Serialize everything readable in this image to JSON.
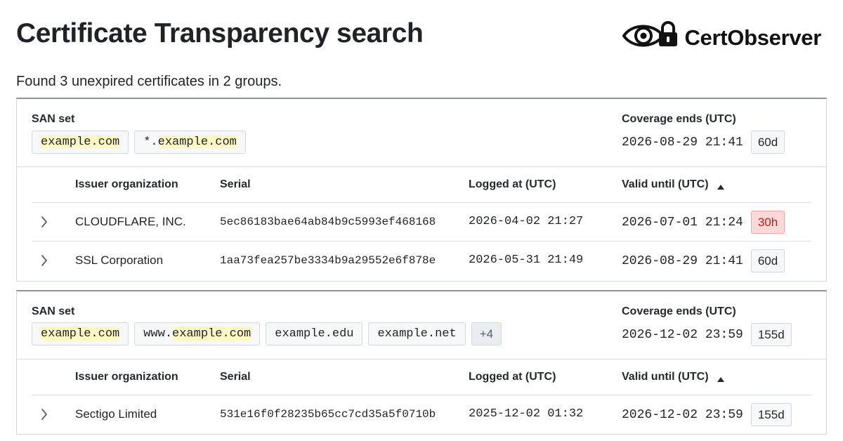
{
  "header": {
    "title": "Certificate Transparency search",
    "brand": "CertObserver",
    "logo_icon": "eye-lock-icon"
  },
  "summary": "Found 3 unexpired certificates in 2 groups.",
  "labels": {
    "san_set": "SAN set",
    "coverage_ends": "Coverage ends (UTC)"
  },
  "columns": {
    "issuer": "Issuer organization",
    "serial": "Serial",
    "logged": "Logged at (UTC)",
    "valid": "Valid until (UTC)",
    "sort_icon": "sort-ascending-icon"
  },
  "groups": [
    {
      "sans": [
        {
          "prefix": "",
          "domain": "example.com"
        },
        {
          "prefix": "*.",
          "domain": "example.com"
        }
      ],
      "coverage_date": "2026-08-29 21:41",
      "coverage_badge": "60d",
      "rows": [
        {
          "issuer": "CLOUDFLARE, INC.",
          "serial": "5ec86183bae64ab84b9c5993ef468168",
          "logged": "2026-04-02 21:27",
          "valid": "2026-07-01 21:24",
          "badge": "30h",
          "badge_status": "warning"
        },
        {
          "issuer": "SSL Corporation",
          "serial": "1aa73fea257be3334b9a29552e6f878e",
          "logged": "2026-05-31 21:49",
          "valid": "2026-08-29 21:41",
          "badge": "60d",
          "badge_status": "normal"
        }
      ]
    },
    {
      "sans": [
        {
          "prefix": "",
          "domain": "example.com"
        },
        {
          "prefix": "www.",
          "domain": "example.com"
        },
        {
          "prefix": "example.edu",
          "domain": ""
        },
        {
          "prefix": "example.net",
          "domain": ""
        }
      ],
      "more_label": "+4",
      "coverage_date": "2026-12-02 23:59",
      "coverage_badge": "155d",
      "rows": [
        {
          "issuer": "Sectigo Limited",
          "serial": "531e16f0f28235b65cc7cd35a5f0710b",
          "logged": "2025-12-02 01:32",
          "valid": "2026-12-02 23:59",
          "badge": "155d",
          "badge_status": "normal"
        }
      ]
    }
  ],
  "colors": {
    "highlight": "#fff8c5",
    "warning_badge_bg": "#ffd8d8",
    "warning_badge_text": "#b42318"
  }
}
